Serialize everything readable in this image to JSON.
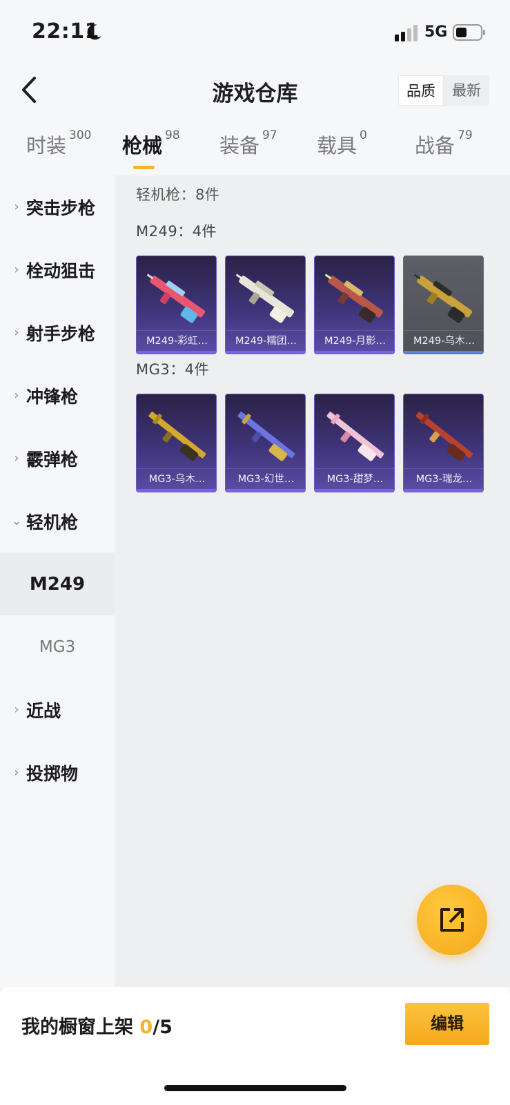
{
  "status_bar": {
    "time": "22:11",
    "network": "5G"
  },
  "header": {
    "title": "游戏仓库",
    "sort_options": [
      "品质",
      "最新"
    ],
    "active_sort": "品质"
  },
  "tabs": [
    {
      "label": "时装",
      "count": "300"
    },
    {
      "label": "枪械",
      "count": "98"
    },
    {
      "label": "装备",
      "count": "97"
    },
    {
      "label": "载具",
      "count": "0"
    },
    {
      "label": "战备",
      "count": "79"
    }
  ],
  "active_tab": "枪械",
  "sidebar": {
    "items": [
      {
        "label": "突击步枪"
      },
      {
        "label": "栓动狙击"
      },
      {
        "label": "射手步枪"
      },
      {
        "label": "冲锋枪"
      },
      {
        "label": "霰弹枪"
      },
      {
        "label": "轻机枪"
      },
      {
        "label": "M249"
      },
      {
        "label": "MG3"
      },
      {
        "label": "近战"
      },
      {
        "label": "投掷物"
      }
    ]
  },
  "content": {
    "section_title": "轻机枪：8件",
    "groups": [
      {
        "title": "M249：4件",
        "items": [
          {
            "name": "M249-彩虹…",
            "accent": "#e8566f"
          },
          {
            "name": "M249-糯团…",
            "accent": "#e8e6d8"
          },
          {
            "name": "M249-月影…",
            "accent": "#b8584a"
          },
          {
            "name": "M249-乌木…",
            "accent": "#c9a33a"
          }
        ]
      },
      {
        "title": "MG3：4件",
        "items": [
          {
            "name": "MG3-乌木…",
            "accent": "#d4a82f"
          },
          {
            "name": "MG3-幻世…",
            "accent": "#6b74e0"
          },
          {
            "name": "MG3-甜梦…",
            "accent": "#f0c4d6"
          },
          {
            "name": "MG3-瑞龙…",
            "accent": "#b8422f"
          }
        ]
      }
    ]
  },
  "bottom": {
    "label": "我的橱窗上架 ",
    "count": "0",
    "total": "/5",
    "edit_label": "编辑"
  }
}
